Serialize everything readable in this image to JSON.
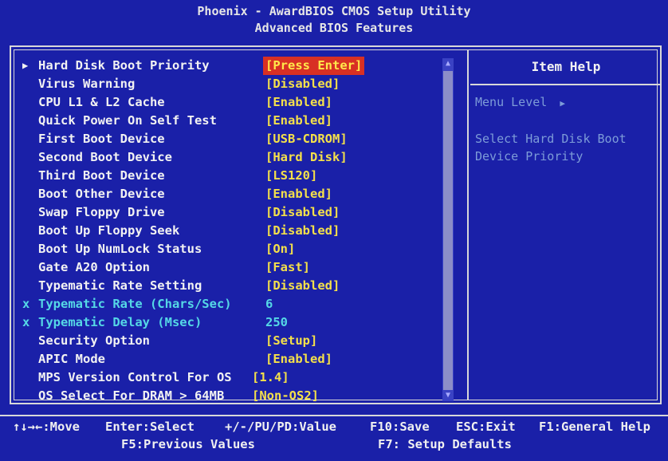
{
  "header": {
    "title": "Phoenix - AwardBIOS CMOS Setup Utility",
    "subtitle": "Advanced BIOS Features"
  },
  "settings": [
    {
      "label": "Hard Disk Boot Priority",
      "value": "[Press Enter]",
      "submenu": true,
      "selected": true
    },
    {
      "label": "Virus Warning",
      "value": "[Disabled]"
    },
    {
      "label": "CPU L1 & L2 Cache",
      "value": "[Enabled]"
    },
    {
      "label": "Quick Power On Self Test",
      "value": "[Enabled]"
    },
    {
      "label": "First Boot Device",
      "value": "[USB-CDROM]"
    },
    {
      "label": "Second Boot Device",
      "value": "[Hard Disk]"
    },
    {
      "label": "Third Boot Device",
      "value": "[LS120]"
    },
    {
      "label": "Boot Other Device",
      "value": "[Enabled]"
    },
    {
      "label": "Swap Floppy Drive",
      "value": "[Disabled]"
    },
    {
      "label": "Boot Up Floppy Seek",
      "value": "[Disabled]"
    },
    {
      "label": "Boot Up NumLock Status",
      "value": "[On]"
    },
    {
      "label": "Gate A20 Option",
      "value": "[Fast]"
    },
    {
      "label": "Typematic Rate Setting",
      "value": "[Disabled]"
    },
    {
      "label": "Typematic Rate (Chars/Sec)",
      "value": "6",
      "disabled": true
    },
    {
      "label": "Typematic Delay (Msec)",
      "value": "250",
      "disabled": true
    },
    {
      "label": "Security Option",
      "value": "[Setup]"
    },
    {
      "label": "APIC Mode",
      "value": "[Enabled]"
    },
    {
      "label": "MPS Version Control For OS",
      "value": "[1.4]"
    },
    {
      "label": "OS Select For DRAM > 64MB",
      "value": "[Non-OS2]"
    }
  ],
  "item_help": {
    "title": "Item Help",
    "menu_level": "Menu Level",
    "description_line1": "Select Hard Disk Boot",
    "description_line2": "Device Priority"
  },
  "footer": {
    "move": "↑↓→←:Move",
    "enter": "Enter:Select",
    "value": "+/-/PU/PD:Value",
    "save": "F10:Save",
    "exit": "ESC:Exit",
    "help": "F1:General Help",
    "previous": "F5:Previous Values",
    "defaults": "F7: Setup Defaults"
  },
  "marker_disabled": "x"
}
